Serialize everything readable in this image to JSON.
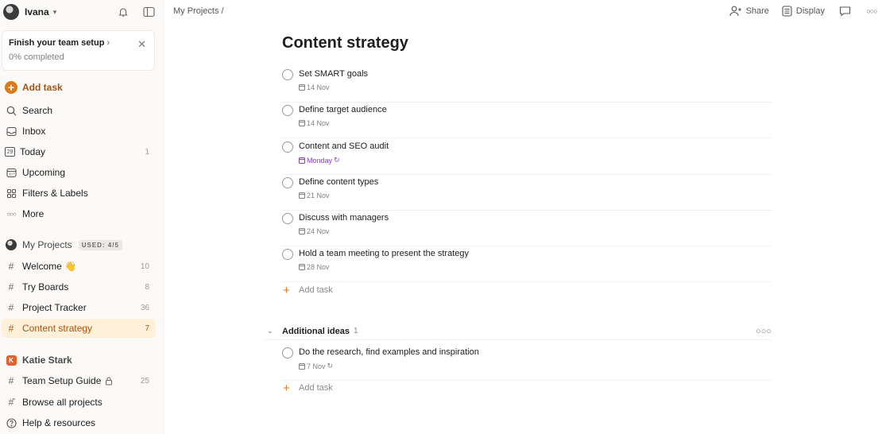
{
  "sidebar": {
    "user_name": "Ivana",
    "setup_card": {
      "title": "Finish your team setup",
      "subtitle": "0% completed"
    },
    "add_task": "Add task",
    "nav": [
      {
        "label": "Search",
        "icon": "search-icon"
      },
      {
        "label": "Inbox",
        "icon": "inbox-icon"
      },
      {
        "label": "Today",
        "icon": "today-icon",
        "today_number": "29",
        "count": "1"
      },
      {
        "label": "Upcoming",
        "icon": "calendar-icon"
      },
      {
        "label": "Filters & Labels",
        "icon": "grid-icon"
      },
      {
        "label": "More",
        "icon": "more-icon"
      }
    ],
    "my_projects": {
      "label": "My Projects",
      "badge": "USED: 4/5"
    },
    "projects": [
      {
        "label": "Welcome 👋",
        "count": "10"
      },
      {
        "label": "Try Boards",
        "count": "8"
      },
      {
        "label": "Project Tracker",
        "count": "36"
      },
      {
        "label": "Content strategy",
        "count": "7",
        "active": true
      }
    ],
    "team": {
      "initial": "K",
      "label": "Katie Stark",
      "items": [
        {
          "label": "Team Setup Guide",
          "count": "25",
          "icon": "hash-icon",
          "locked": true
        },
        {
          "label": "Browse all projects",
          "icon": "browse-icon"
        },
        {
          "label": "Help & resources",
          "icon": "help-icon"
        }
      ]
    }
  },
  "header": {
    "breadcrumb": "My Projects /",
    "share": "Share",
    "display": "Display"
  },
  "main": {
    "title": "Content strategy",
    "tasks": [
      {
        "name": "Set SMART goals",
        "date": "14 Nov"
      },
      {
        "name": "Define target audience",
        "date": "14 Nov"
      },
      {
        "name": "Content and SEO audit",
        "date": "Monday",
        "recurring": true,
        "date_color": "#8e3bd6"
      },
      {
        "name": "Define content types",
        "date": "21 Nov"
      },
      {
        "name": "Discuss with managers",
        "date": "24 Nov"
      },
      {
        "name": "Hold a team meeting to present the strategy",
        "date": "28 Nov"
      }
    ],
    "add_task": "Add task",
    "section": {
      "name": "Additional ideas",
      "count": "1",
      "tasks": [
        {
          "name": "Do the research, find examples and inspiration",
          "date": "7 Nov",
          "recurring": true
        }
      ],
      "add_task": "Add task"
    }
  },
  "colors": {
    "accent": "#dc7a17",
    "active_bg": "#fff0d9",
    "active_text": "#a5540d",
    "team_badge": "#e0632f"
  }
}
